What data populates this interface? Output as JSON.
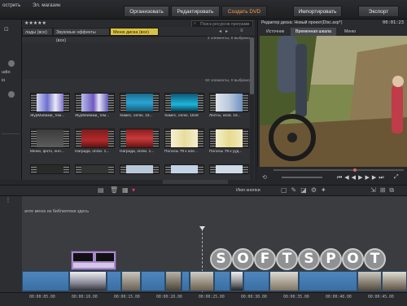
{
  "menu": {
    "item1": "острить",
    "item2": "Эл. магазин"
  },
  "modes": {
    "organize": "Организовать",
    "edit": "Редактировать",
    "create_dvd": "Создать DVD"
  },
  "right_buttons": {
    "import": "Импортировать",
    "export": "Экспорт"
  },
  "left_panel": {
    "label1": "udio",
    "label2": "io"
  },
  "library": {
    "tabs": [
      "лады (все)",
      "Звуковые эффекты (все)",
      "Меню диска (все)"
    ],
    "search_placeholder": "Поиск ресурсов программ",
    "count_top": "2 элементы, 0 выбрано",
    "count_bottom": "92 элементы, 0 выбрано",
    "tiles_row1": [
      "ЖурМайами_тем...",
      "ЖурМайами_тем...",
      "Химес, оплю. 16...",
      "Химес, оплю. 16x9",
      "Лепты, кпов. 16..."
    ],
    "tiles_row2": [
      "Меню, фото, онл...",
      "Награда, оплю. 1...",
      "Награда, оплю. 1...",
      "Полосы 79 к але...",
      "Полосы 79 к ууд..."
    ]
  },
  "preview": {
    "title": "Редактор диска: Новый проект(Disc.axp*)",
    "timecode": "00:01:23",
    "tabs": [
      "Источник",
      "Временная шкала",
      "Меню"
    ]
  },
  "timeline": {
    "button_name": "Имя кнопки",
    "hint": "ачте меню из библиотеки здесь",
    "ruler": [
      "00:00:05.00",
      "00:00:10.00",
      "00:00:15.00",
      "00:00:20.00",
      "00:00:25.00",
      "00:00:30.00",
      "00:00:35.00",
      "00:00:40.00",
      "00:00:45.00"
    ]
  },
  "watermark": {
    "letters": [
      "S",
      "O",
      "F",
      "T",
      "S",
      "P",
      "O",
      "T"
    ]
  },
  "colors": {
    "accent": "#ff9a3c",
    "tab_active": "#d9c241",
    "clip": "#4a80b6"
  }
}
